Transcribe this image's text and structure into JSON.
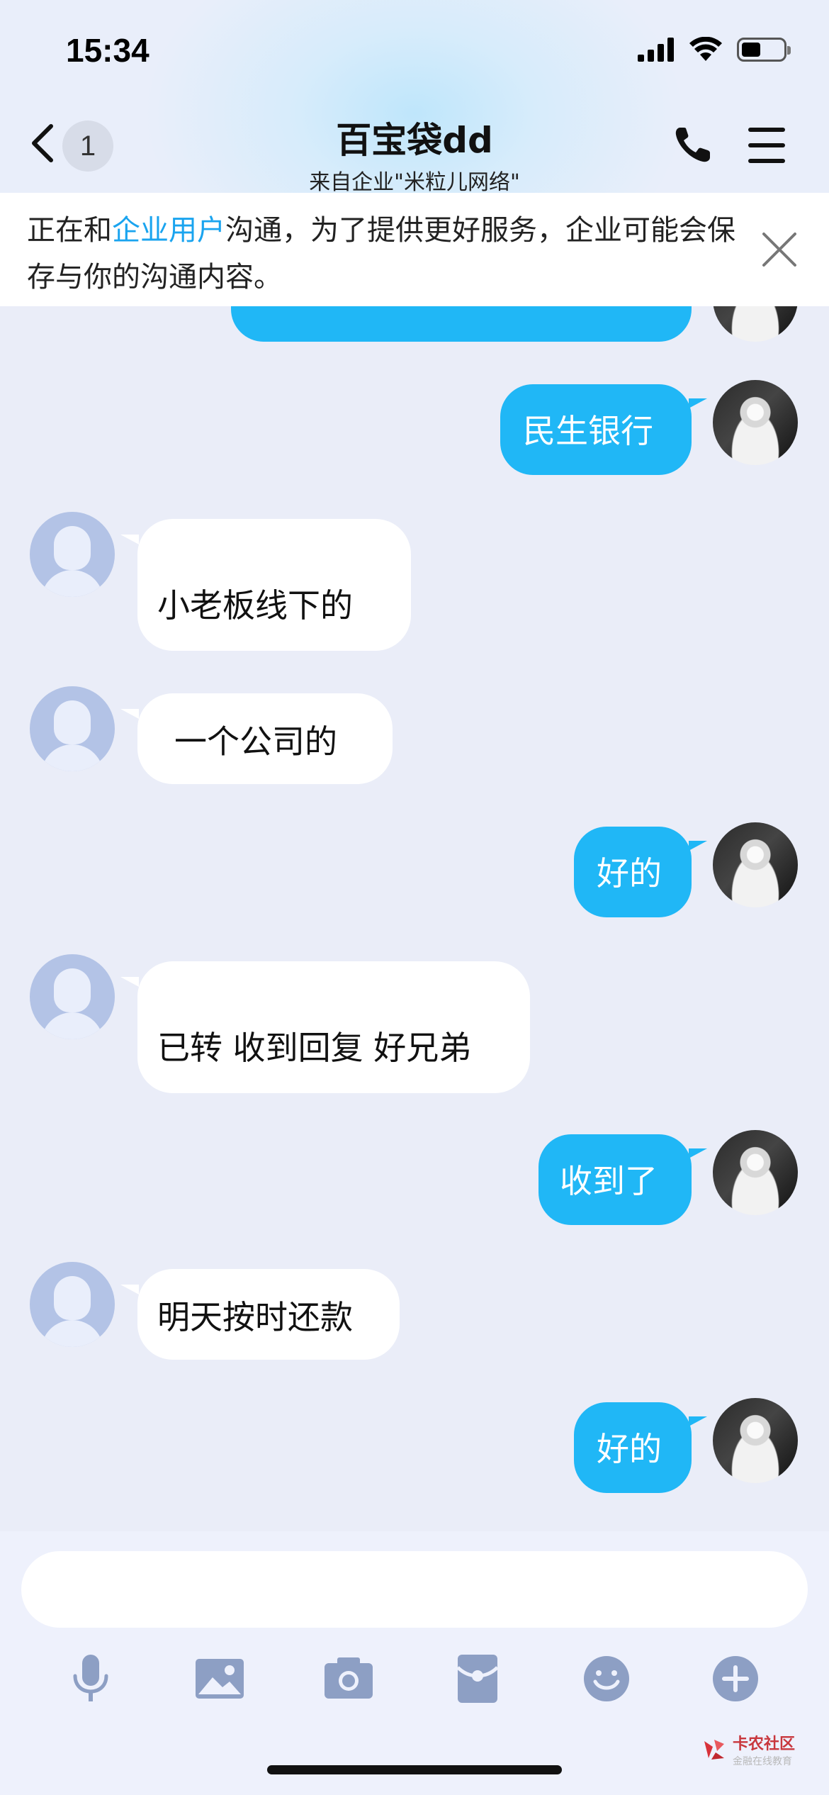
{
  "status_bar": {
    "time": "15:34"
  },
  "header": {
    "back_badge": "1",
    "title": "百宝袋dd",
    "subtitle": "来自企业\"米粒儿网络\""
  },
  "banner": {
    "text_before": "正在和",
    "highlight": "企业用户",
    "text_after": "沟通，为了提供更好服务，企业可能会保存与你的沟通内容。"
  },
  "messages": [
    {
      "from": "me",
      "text": "民生银行"
    },
    {
      "from": "them",
      "text": "小老板线下的"
    },
    {
      "from": "them",
      "text": "一个公司的"
    },
    {
      "from": "me",
      "text": "好的"
    },
    {
      "from": "them",
      "text": "已转 收到回复 好兄弟"
    },
    {
      "from": "me",
      "text": "收到了"
    },
    {
      "from": "them",
      "text": "明天按时还款"
    },
    {
      "from": "me",
      "text": "好的"
    }
  ],
  "toolbar": {
    "icons": [
      "microphone-icon",
      "image-icon",
      "camera-icon",
      "red-packet-icon",
      "emoji-icon",
      "plus-icon"
    ]
  },
  "watermark": {
    "name": "卡农社区",
    "tagline": "金融在线教育"
  },
  "colors": {
    "accent": "#20b7f6",
    "link": "#1aa4ef",
    "background": "#eaedf8"
  }
}
